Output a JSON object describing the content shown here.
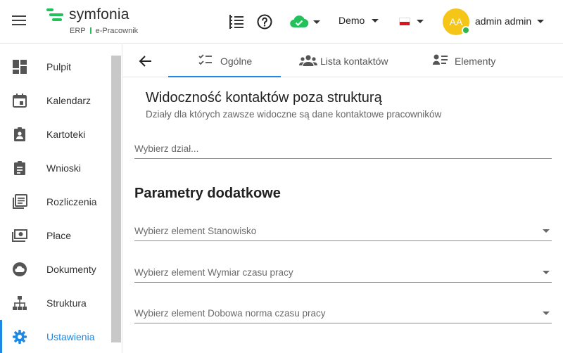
{
  "header": {
    "logo": {
      "name": "symfonia",
      "product": "ERP",
      "module": "e-Pracownik"
    },
    "company": "Demo",
    "language_flag": "pl-flag",
    "user": {
      "initials": "AA",
      "name": "admin admin",
      "status_color": "#2bb54b"
    },
    "cloud_status_color": "#22c15a",
    "accent_color": "#1e88e5"
  },
  "sidebar": {
    "items": [
      {
        "label": "Pulpit",
        "icon": "dashboard-icon"
      },
      {
        "label": "Kalendarz",
        "icon": "calendar-icon"
      },
      {
        "label": "Kartoteki",
        "icon": "id-card-icon"
      },
      {
        "label": "Wnioski",
        "icon": "clipboard-icon"
      },
      {
        "label": "Rozliczenia",
        "icon": "documents-icon"
      },
      {
        "label": "Płace",
        "icon": "money-icon"
      },
      {
        "label": "Dokumenty",
        "icon": "cloud-icon"
      },
      {
        "label": "Struktura",
        "icon": "hierarchy-icon"
      },
      {
        "label": "Ustawienia",
        "icon": "gear-icon",
        "active": true
      }
    ]
  },
  "tabs": [
    {
      "label": "Ogólne",
      "icon": "checklist-icon",
      "active": true
    },
    {
      "label": "Lista kontaktów",
      "icon": "contacts-icon"
    },
    {
      "label": "Elementy",
      "icon": "list-person-icon"
    }
  ],
  "section1": {
    "title": "Widoczność kontaktów poza strukturą",
    "subtitle": "Działy dla których zawsze widoczne są dane kontaktowe pracowników",
    "department_placeholder": "Wybierz dział..."
  },
  "section2": {
    "title": "Parametry dodatkowe",
    "fields": [
      "Wybierz element Stanowisko",
      "Wybierz element Wymiar czasu pracy",
      "Wybierz element Dobowa norma czasu pracy"
    ]
  }
}
